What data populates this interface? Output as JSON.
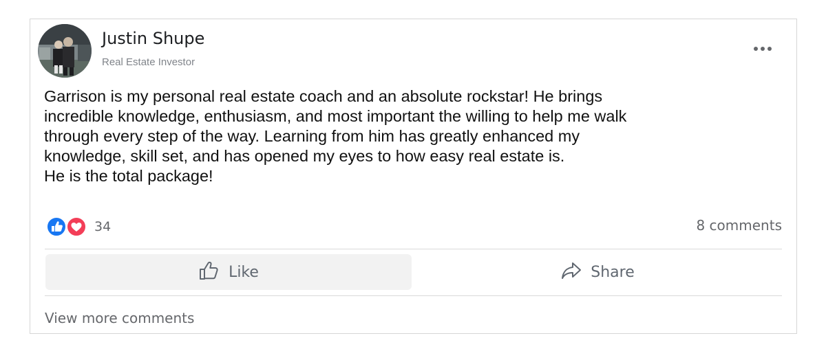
{
  "post": {
    "author_name": "Justin Shupe",
    "author_title": "Real Estate Investor",
    "body_lines": [
      "Garrison is my personal real estate coach and an absolute rockstar! He brings",
      "incredible knowledge, enthusiasm, and most important the willing to help me walk",
      "through every step of the way. Learning from him has greatly enhanced my",
      "knowledge, skill set, and has opened my eyes to how easy real estate is.",
      "He is the total package!"
    ]
  },
  "reactions": {
    "icons": [
      "like-reaction-icon",
      "love-reaction-icon"
    ],
    "count": "34"
  },
  "comments": {
    "count_label": "8 comments",
    "view_more_label": "View more comments"
  },
  "actions": {
    "like_label": "Like",
    "like_icon": "thumbs-up-icon",
    "share_label": "Share",
    "share_icon": "share-arrow-icon"
  },
  "header": {
    "more_icon": "more-options-icon"
  },
  "colors": {
    "like_blue": "#1877f2",
    "love_red": "#f33e58",
    "muted_text": "#65676b",
    "button_bg": "#f2f2f2"
  }
}
